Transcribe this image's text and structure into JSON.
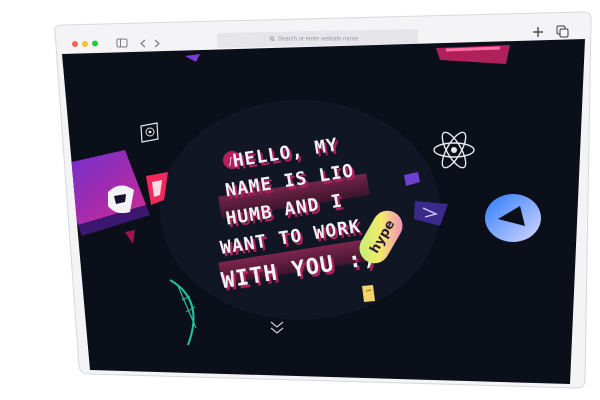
{
  "browser": {
    "address_placeholder": "Search or enter website name",
    "icons": [
      "close-dot",
      "minimize-dot",
      "zoom-dot",
      "sidebar-icon",
      "back-icon",
      "forward-icon",
      "search-icon",
      "new-tab-icon",
      "tabs-overview-icon"
    ]
  },
  "page": {
    "headline_lines": [
      "HELLO, MY",
      "NAME IS LIO",
      "HUMB AND I",
      "WANT TO WORK",
      "WITH YOU :)"
    ],
    "sticker_text": "hype",
    "background_color": "#0b0f19",
    "accent_colors": [
      "#8b2fd6",
      "#d8258c",
      "#ffffff"
    ],
    "decor_icons": [
      "at-sign-icon",
      "gatsby-icon",
      "html5-icon",
      "laptop-icon",
      "react-icon",
      "sparkle-icon",
      "vercel-icon",
      "storybook-icon",
      "leaf-icon",
      "pill-sticker-icon",
      "scroll-down-icon"
    ]
  }
}
